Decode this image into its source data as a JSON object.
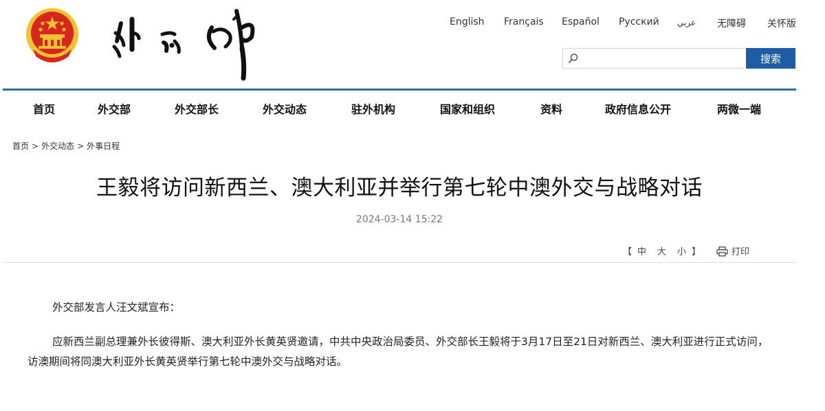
{
  "header": {
    "logo_alt": "外交部",
    "languages": [
      "English",
      "Français",
      "Español",
      "Русский",
      "عربي",
      "无障碍",
      "关怀版"
    ],
    "search": {
      "placeholder": "",
      "button_label": "搜索"
    }
  },
  "nav": {
    "items": [
      "首页",
      "外交部",
      "外交部长",
      "外交动态",
      "驻外机构",
      "国家和组织",
      "资料",
      "政府信息公开",
      "两微一端"
    ]
  },
  "breadcrumb": {
    "items": [
      "首页",
      "外交动态",
      "外事日程"
    ],
    "separator": ">"
  },
  "article": {
    "title": "王毅将访问新西兰、澳大利亚并举行第七轮中澳外交与战略对话",
    "date": "2024-03-14 15:22",
    "font_size": {
      "open": "【",
      "large": "中",
      "medium": "大",
      "small": "小",
      "close": "】"
    },
    "print_label": "打印",
    "paragraphs": [
      "外交部发言人汪文斌宣布：",
      "应新西兰副总理兼外长彼得斯、澳大利亚外长黄英贤邀请，中共中央政治局委员、外交部长王毅将于3月17日至21日对新西兰、澳大利亚进行正式访问，访澳期间将同澳大利亚外长黄英贤举行第七轮中澳外交与战略对话。"
    ]
  },
  "colors": {
    "nav_line": "#2d6aa8",
    "search_button": "#1f5ca6",
    "divider": "#cfe0ee",
    "emblem_red": "#d7261e",
    "emblem_gold": "#f2c230"
  },
  "icons": [
    "state-emblem-icon",
    "search-icon",
    "print-icon"
  ]
}
